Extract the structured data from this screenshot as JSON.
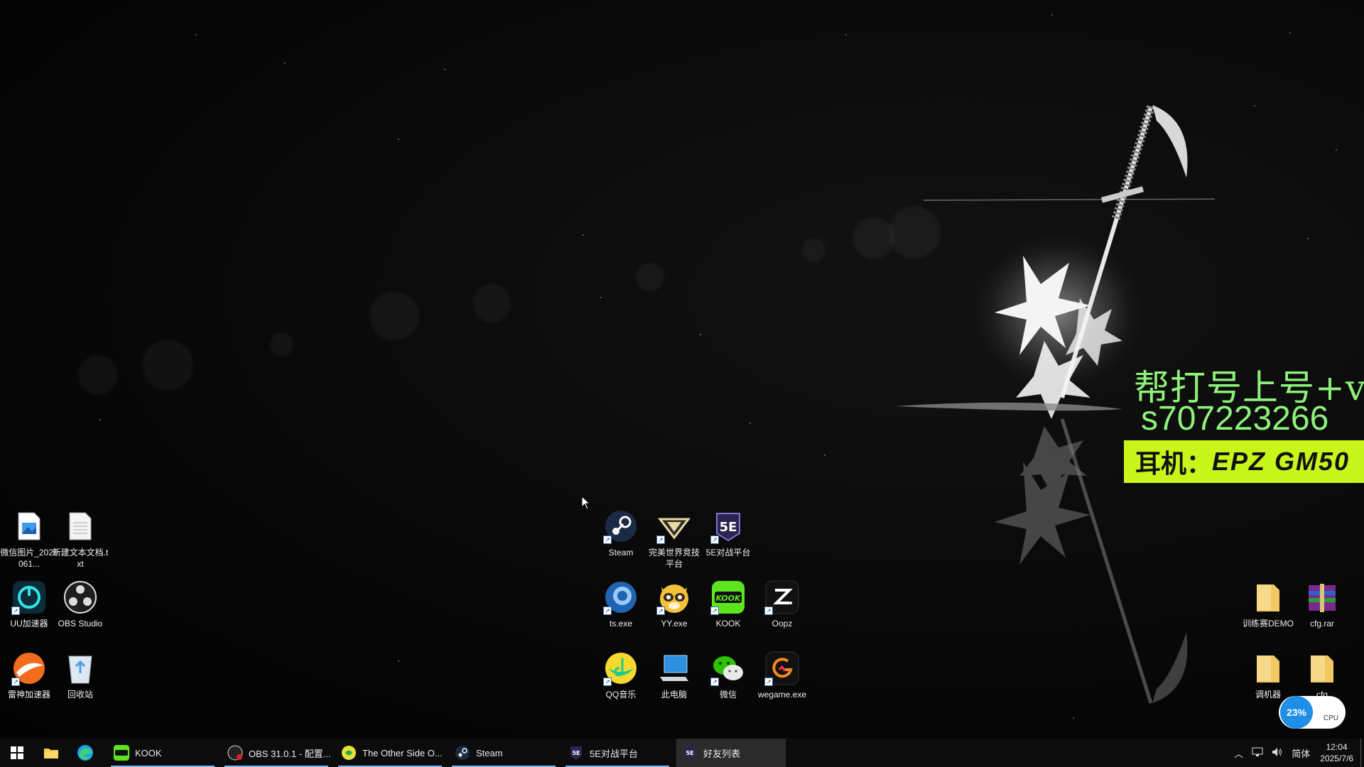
{
  "overlay": {
    "promo_line1": "帮打号上号+v:",
    "promo_line2": "s707223266",
    "headset_label": "耳机：",
    "headset_model": "EPZ GM50"
  },
  "desktop_icons": {
    "wechat_image": "微信图片_2025061...",
    "new_text_file": "新建文本文档.txt",
    "uu": "UU加速器",
    "obs": "OBS Studio",
    "leishen": "雷神加速器",
    "recycle": "回收站",
    "steam": "Steam",
    "perfect_world": "完美世界竞技平台",
    "fivee": "5E对战平台",
    "ts": "ts.exe",
    "yy": "YY.exe",
    "kook": "KOOK",
    "oopz": "Oopz",
    "qqmusic": "QQ音乐",
    "this_pc": "此电脑",
    "weixin": "微信",
    "wegame": "wegame.exe",
    "training_demo": "训练赛DEMO",
    "cfg_rar": "cfg.rar",
    "tuner": "调机器",
    "cfg": "cfg"
  },
  "perf_widget": {
    "cpu_percent": "23%",
    "label": "CPU"
  },
  "taskbar": {
    "apps": [
      {
        "label": "KOOK"
      },
      {
        "label": "OBS 31.0.1 - 配置..."
      },
      {
        "label": "The Other Side O..."
      },
      {
        "label": "Steam"
      },
      {
        "label": "5E对战平台"
      },
      {
        "label": "好友列表"
      }
    ],
    "tray": {
      "ime": "简体",
      "time": "12:04",
      "date": "2025/7/6"
    }
  },
  "colors": {
    "promo_green": "#8ef27a",
    "banner_yellow": "#c8f51a",
    "kook_green": "#5ce51e",
    "taskbar_bg": "#0c0c0c"
  }
}
